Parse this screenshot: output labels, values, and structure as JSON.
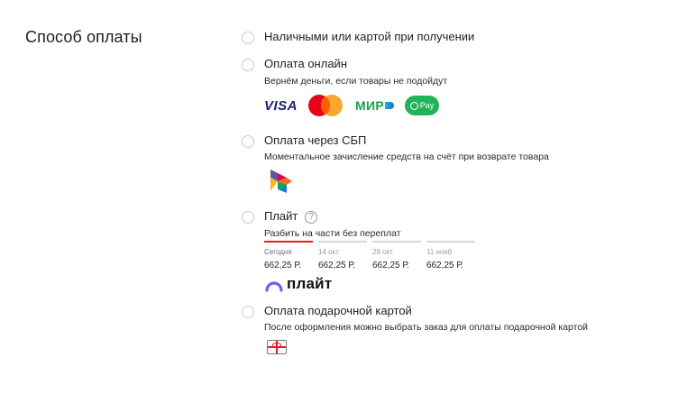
{
  "section_title": "Способ оплаты",
  "options": {
    "cash": {
      "label": "Наличными или картой при получении"
    },
    "online": {
      "label": "Оплата онлайн",
      "sub": "Вернём деньги, если товары не подойдут",
      "logos": {
        "visa": "VISA",
        "mir": "МИР",
        "pay": "Pay"
      }
    },
    "sbp": {
      "label": "Оплата через СБП",
      "sub": "Моментальное зачисление средств на счёт при возврате товара"
    },
    "plait": {
      "label": "Плайт",
      "help": "?",
      "sub": "Разбить на части без переплат",
      "schedule": [
        {
          "date": "Сегодня",
          "amount": "662,25 Р."
        },
        {
          "date": "14 окт",
          "amount": "662,25 Р."
        },
        {
          "date": "28 окт",
          "amount": "662,25 Р."
        },
        {
          "date": "11 нояб",
          "amount": "662,25 Р."
        }
      ],
      "logo_text": "плайт"
    },
    "gift": {
      "label": "Оплата подарочной картой",
      "sub": "После оформления можно выбрать заказ для оплаты подарочной картой"
    }
  },
  "colors": {
    "accent": "#e31b23",
    "radio_border": "#c9c9c9"
  }
}
